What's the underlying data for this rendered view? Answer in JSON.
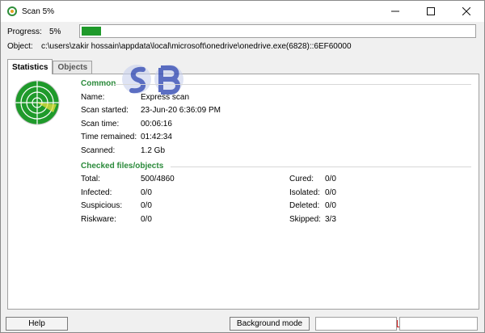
{
  "window": {
    "title": "Scan 5%",
    "minimize_icon": "minimize-icon",
    "maximize_icon": "maximize-icon",
    "close_icon": "close-icon"
  },
  "progress": {
    "label": "Progress:",
    "percent_text": "5%",
    "fraction": 0.05,
    "fill_color": "#1f9a2b"
  },
  "object": {
    "label": "Object:",
    "path": "c:\\users\\zakir hossain\\appdata\\local\\microsoft\\onedrive\\onedrive.exe(6828)::6EF60000"
  },
  "tabs": [
    {
      "label": "Statistics",
      "active": true
    },
    {
      "label": "Objects",
      "active": false
    }
  ],
  "common": {
    "title": "Common",
    "rows": [
      {
        "label": "Name:",
        "value": "Express scan"
      },
      {
        "label": "Scan started:",
        "value": "23-Jun-20 6:36:09 PM"
      },
      {
        "label": "Scan time:",
        "value": "00:06:16"
      },
      {
        "label": "Time remained:",
        "value": "01:42:34"
      },
      {
        "label": "Scanned:",
        "value": "1.2 Gb"
      }
    ]
  },
  "checked": {
    "title": "Checked files/objects",
    "left": [
      {
        "label": "Total:",
        "value": "500/4860"
      },
      {
        "label": "Infected:",
        "value": "0/0"
      },
      {
        "label": "Suspicious:",
        "value": "0/0"
      },
      {
        "label": "Riskware:",
        "value": "0/0"
      }
    ],
    "right": [
      {
        "label": "Cured:",
        "value": "0/0"
      },
      {
        "label": "Isolated:",
        "value": "0/0"
      },
      {
        "label": "Deleted:",
        "value": "0/0"
      },
      {
        "label": "Skipped:",
        "value": "3/3"
      }
    ]
  },
  "footer": {
    "help_label": "Help",
    "background_label": "Background mode"
  },
  "colors": {
    "accent_green": "#2a8a3a",
    "radar_green": "#1f9a2b"
  },
  "icons": {
    "app": "scanner-app-icon",
    "radar": "radar-icon",
    "watermark": "sb-watermark-logo"
  }
}
